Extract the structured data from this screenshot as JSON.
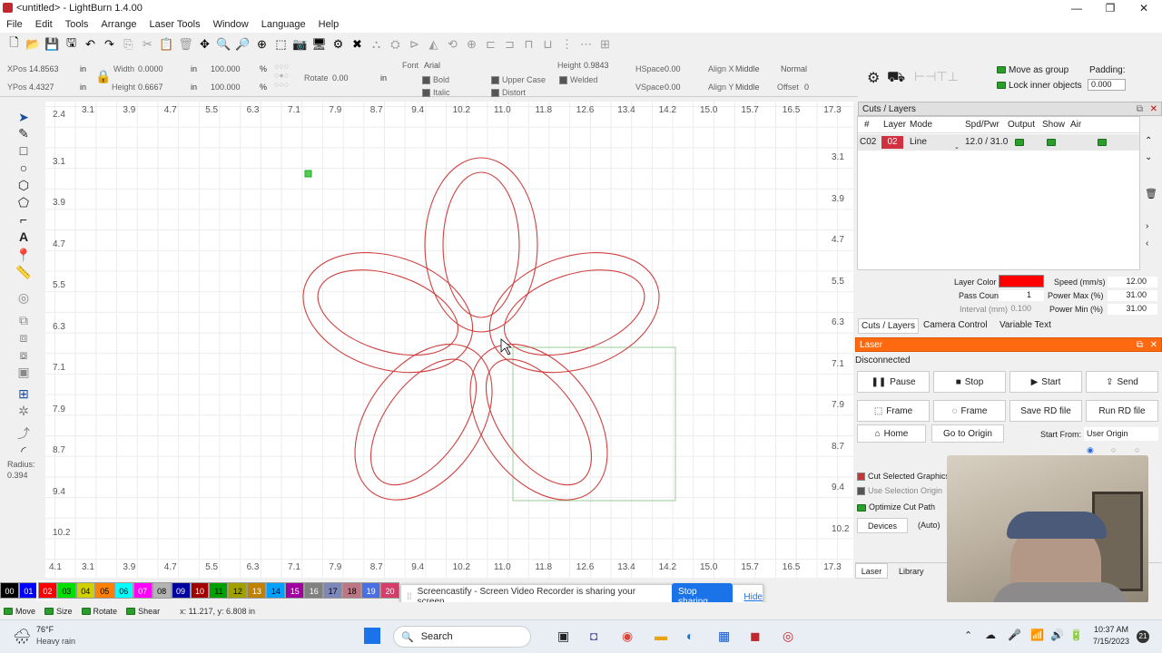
{
  "window": {
    "title": "<untitled> - LightBurn 1.4.00",
    "minimize": "—",
    "maximize": "❐",
    "close": "✕"
  },
  "menu": [
    "File",
    "Edit",
    "Tools",
    "Arrange",
    "Laser Tools",
    "Window",
    "Language",
    "Help"
  ],
  "props": {
    "xpos_label": "XPos",
    "xpos": "14.8563",
    "ypos_label": "YPos",
    "ypos": "4.4327",
    "width_label": "Width",
    "width": "0.0000",
    "height_label": "Height",
    "height": "0.6667",
    "unit": "in",
    "scale_x": "100.000",
    "scale_y": "100.000",
    "pct": "%",
    "rotate_label": "Rotate",
    "rotate": "0.00",
    "rotate_unit": "in",
    "font_label": "Font",
    "font": "Arial",
    "height2_label": "Height",
    "height2": "0.9843",
    "hspace_label": "HSpace",
    "hspace": "0.00",
    "vspace_label": "VSpace",
    "vspace": "0.00",
    "alignx_label": "Align X",
    "alignx": "Middle",
    "aligny_label": "Align Y",
    "aligny": "Middle",
    "normal": "Normal",
    "offset_label": "Offset",
    "offset": "0",
    "bold": "Bold",
    "italic": "Italic",
    "upper": "Upper Case",
    "distort": "Distort",
    "welded": "Welded",
    "move_group": "Move as group",
    "lock_inner": "Lock inner objects",
    "padding_label": "Padding:",
    "padding": "0.000"
  },
  "ruler": {
    "top": [
      "3.1",
      "3.9",
      "4.7",
      "5.5",
      "6.3",
      "7.1",
      "7.9",
      "8.7",
      "9.4",
      "10.2",
      "11.0",
      "11.8",
      "12.6",
      "13.4",
      "14.2",
      "15.0",
      "15.7",
      "16.5",
      "17.3"
    ],
    "bottom": [
      "4.1",
      "3.1",
      "3.9",
      "4.7",
      "5.5",
      "6.3",
      "7.1",
      "7.9",
      "8.7",
      "9.4",
      "10.2",
      "11.0",
      "11.8",
      "12.6",
      "13.4",
      "14.2",
      "15.0",
      "15.7",
      "16.5",
      "17.3"
    ],
    "left": [
      "2.4",
      "3.1",
      "3.9",
      "4.7",
      "5.5",
      "6.3",
      "7.1",
      "7.9",
      "8.7",
      "9.4",
      "10.2"
    ],
    "right": [
      "3.1",
      "3.9",
      "4.7",
      "5.5",
      "6.3",
      "7.1",
      "7.9",
      "8.7",
      "9.4",
      "10.2"
    ],
    "radius_label": "Radius:",
    "radius": "0.394"
  },
  "cuts": {
    "title": "Cuts / Layers",
    "headers": [
      "#",
      "Layer",
      "Mode",
      "Spd/Pwr",
      "Output",
      "Show",
      "Air"
    ],
    "row": {
      "id": "C02",
      "layer": "02",
      "mode": "Line",
      "spdpwr": "12.0 / 31.0"
    },
    "layer_color_label": "Layer Color",
    "layer_color": "#ff0000",
    "pass_label": "Pass Count",
    "pass": "1",
    "interval_label": "Interval (mm)",
    "interval": "0.100",
    "speed_label": "Speed (mm/s)",
    "speed": "12.00",
    "pmax_label": "Power Max (%)",
    "pmax": "31.00",
    "pmin_label": "Power Min (%)",
    "pmin": "31.00",
    "tabs": [
      "Cuts / Layers",
      "Camera Control",
      "Variable Text"
    ]
  },
  "laser": {
    "title": "Laser",
    "status": "Disconnected",
    "buttons": [
      "Pause",
      "Stop",
      "Start",
      "Send",
      "Frame",
      "Frame",
      "Save RD file",
      "Run RD file",
      "Home",
      "Go to Origin"
    ],
    "start_from_label": "Start From:",
    "start_from": "User Origin",
    "cut_selected": "Cut Selected Graphics",
    "use_selection": "Use Selection Origin",
    "optimize": "Optimize Cut Path",
    "devices": "Devices",
    "auto": "(Auto)",
    "tabs": [
      "Laser",
      "Library"
    ]
  },
  "palette": [
    "00",
    "01",
    "02",
    "03",
    "04",
    "05",
    "06",
    "07",
    "08",
    "09",
    "10",
    "11",
    "12",
    "13",
    "14",
    "15",
    "16",
    "17",
    "18",
    "19",
    "20"
  ],
  "palette_colors": [
    "#000000",
    "#0000ff",
    "#ff0000",
    "#00e000",
    "#d0d000",
    "#ff8000",
    "#00ffff",
    "#ff00ff",
    "#b4b4b4",
    "#0000a0",
    "#a00000",
    "#00a000",
    "#a0a000",
    "#c08000",
    "#00a0ff",
    "#a000a0",
    "#808080",
    "#7d87b9",
    "#bb7784",
    "#4a6fe3",
    "#d33f6a"
  ],
  "status": {
    "move": "Move",
    "size": "Size",
    "rotate": "Rotate",
    "shear": "Shear",
    "coords": "x: 11.217, y: 6.808 in"
  },
  "share": {
    "text": "Screencastify - Screen Video Recorder is sharing your screen.",
    "stop": "Stop sharing",
    "hide": "Hide"
  },
  "taskbar": {
    "temp": "76°F",
    "weather": "Heavy rain",
    "search": "Search",
    "time": "10:37 AM",
    "date": "7/15/2023",
    "notif": "21"
  }
}
